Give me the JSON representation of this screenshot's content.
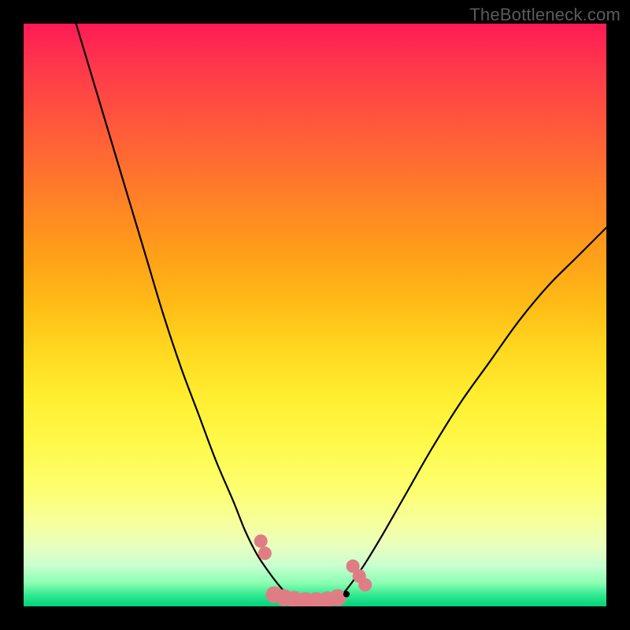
{
  "watermark": {
    "text": "TheBottleneck.com"
  },
  "chart_data": {
    "type": "line",
    "title": "",
    "xlabel": "",
    "ylabel": "",
    "xlim": [
      0,
      100
    ],
    "ylim": [
      0,
      100
    ],
    "grid": false,
    "background": "rainbow-gradient-red-to-green",
    "series": [
      {
        "name": "left-branch",
        "x": [
          9,
          12,
          15,
          18,
          21,
          24,
          27,
          30,
          33,
          36,
          38,
          40,
          42,
          43.5,
          44.8,
          46
        ],
        "y": [
          100,
          90,
          80,
          70,
          60,
          50,
          41,
          33,
          25,
          18,
          13,
          9,
          6,
          4,
          2.5,
          1.3
        ]
      },
      {
        "name": "right-branch",
        "x": [
          54,
          55.5,
          57,
          59,
          62,
          66,
          70,
          75,
          80,
          85,
          90,
          95,
          100
        ],
        "y": [
          1.3,
          3,
          5,
          8,
          13,
          20,
          27,
          35,
          42,
          49,
          55,
          60,
          65
        ]
      }
    ],
    "marker_groups": [
      {
        "name": "left-cluster-upper",
        "color": "#e07d84",
        "radius_pct": 1.15,
        "points": [
          {
            "x": 40.7,
            "y": 11.2
          },
          {
            "x": 41.4,
            "y": 9.1
          }
        ]
      },
      {
        "name": "right-cluster-upper",
        "color": "#e07d84",
        "radius_pct": 1.15,
        "points": [
          {
            "x": 56.5,
            "y": 6.9
          },
          {
            "x": 57.6,
            "y": 5.2
          },
          {
            "x": 58.6,
            "y": 3.7
          }
        ]
      },
      {
        "name": "bottom-flat-cluster",
        "color": "#e07d84",
        "radius_pct": 1.45,
        "points": [
          {
            "x": 43.0,
            "y": 2.0
          },
          {
            "x": 44.7,
            "y": 1.5
          },
          {
            "x": 46.4,
            "y": 1.2
          },
          {
            "x": 48.3,
            "y": 1.0
          },
          {
            "x": 50.2,
            "y": 1.0
          },
          {
            "x": 52.1,
            "y": 1.1
          },
          {
            "x": 53.9,
            "y": 1.5
          }
        ]
      },
      {
        "name": "black-dot",
        "color": "#000000",
        "radius_pct": 0.55,
        "points": [
          {
            "x": 55.4,
            "y": 2.1
          }
        ]
      }
    ]
  }
}
